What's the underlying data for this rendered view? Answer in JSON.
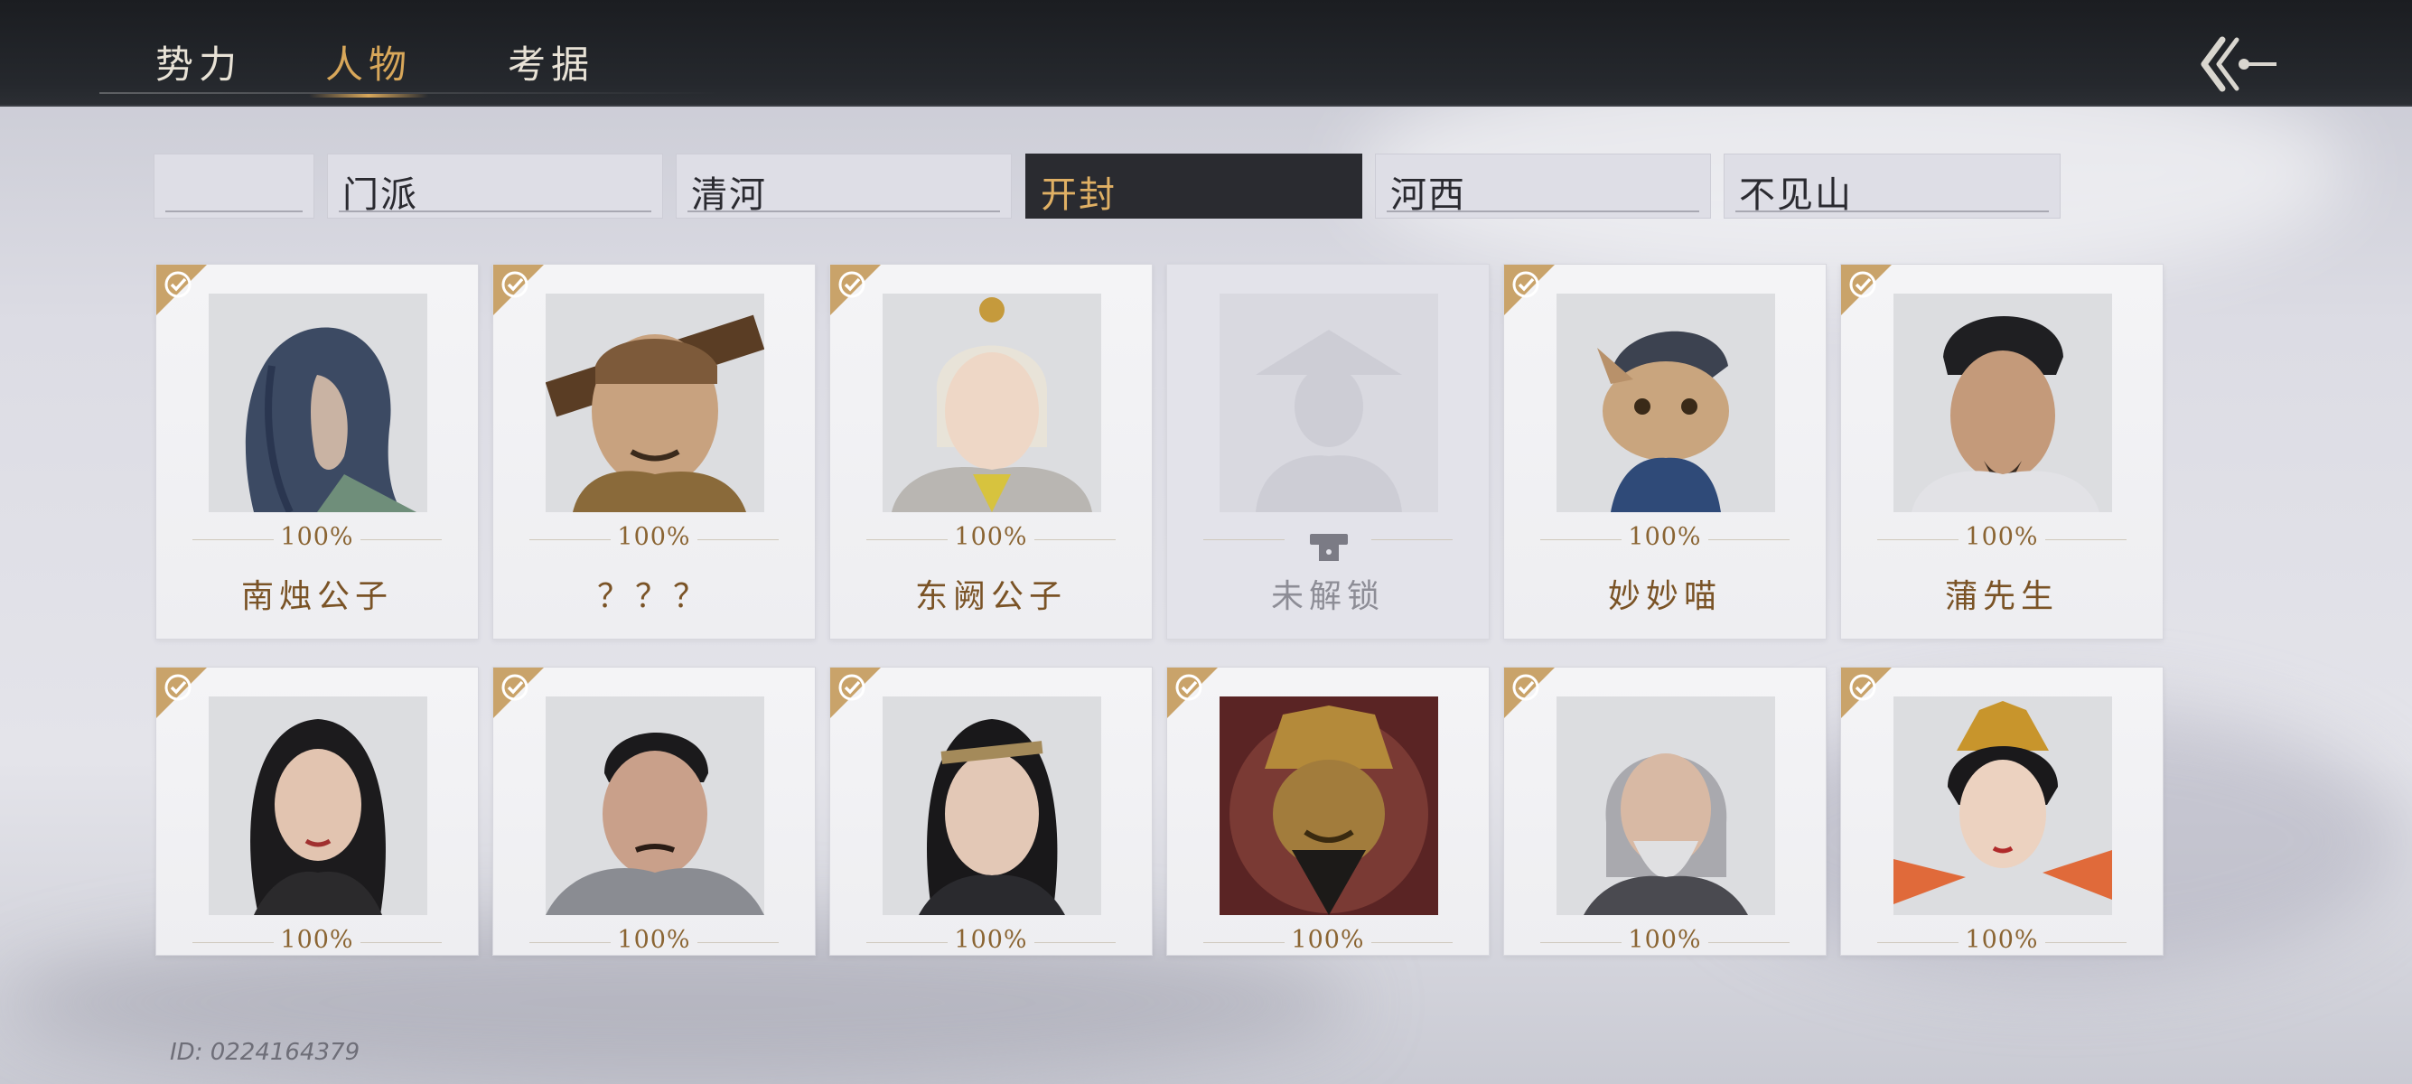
{
  "top_tabs": [
    {
      "label": "势力"
    },
    {
      "label": "人物",
      "active": true
    },
    {
      "label": "考据"
    }
  ],
  "region_tabs": [
    {
      "label": ""
    },
    {
      "label": "门派"
    },
    {
      "label": "清河"
    },
    {
      "label": "开封",
      "active": true
    },
    {
      "label": "河西"
    },
    {
      "label": "不见山"
    }
  ],
  "cards": [
    {
      "name": "南烛公子",
      "progress": "100%",
      "unlocked": true
    },
    {
      "name": "？？？",
      "progress": "100%",
      "unlocked": true
    },
    {
      "name": "东阙公子",
      "progress": "100%",
      "unlocked": true
    },
    {
      "name": "未解锁",
      "progress": "",
      "unlocked": false
    },
    {
      "name": "妙妙喵",
      "progress": "100%",
      "unlocked": true
    },
    {
      "name": "蒲先生",
      "progress": "100%",
      "unlocked": true
    },
    {
      "name": "",
      "progress": "100%",
      "unlocked": true
    },
    {
      "name": "",
      "progress": "100%",
      "unlocked": true
    },
    {
      "name": "",
      "progress": "100%",
      "unlocked": true
    },
    {
      "name": "",
      "progress": "100%",
      "unlocked": true
    },
    {
      "name": "",
      "progress": "100%",
      "unlocked": true
    },
    {
      "name": "",
      "progress": "100%",
      "unlocked": true
    }
  ],
  "footer": {
    "uid": "ID: 0224164379"
  },
  "colors": {
    "accent_gold": "#d8a75a",
    "badge": "#c9a36a",
    "topbar": "#1b1d21"
  }
}
